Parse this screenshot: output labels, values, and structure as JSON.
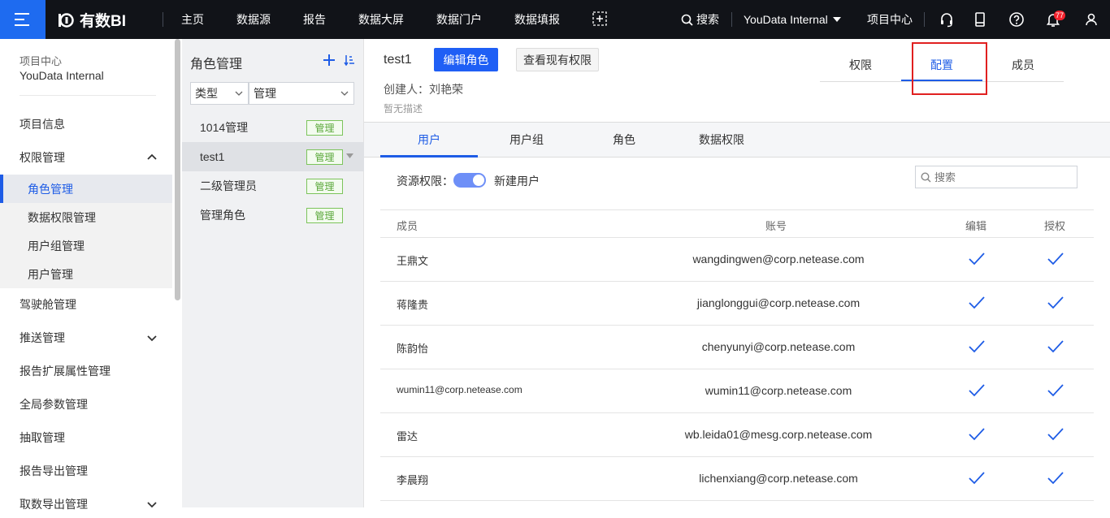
{
  "topbar": {
    "logo": "有数BI",
    "nav": [
      "主页",
      "数据源",
      "报告",
      "数据大屏",
      "数据门户",
      "数据填报"
    ],
    "search_label": "搜索",
    "project": "YouData Internal",
    "project_center": "项目中心",
    "notification_count": "77"
  },
  "sidebar": {
    "header_label": "项目中心",
    "header_project": "YouData Internal",
    "items": [
      {
        "label": "项目信息"
      },
      {
        "label": "权限管理"
      },
      {
        "label": "驾驶舱管理"
      },
      {
        "label": "推送管理"
      },
      {
        "label": "报告扩展属性管理"
      },
      {
        "label": "全局参数管理"
      },
      {
        "label": "抽取管理"
      },
      {
        "label": "报告导出管理"
      },
      {
        "label": "取数导出管理"
      }
    ],
    "sub_items": [
      {
        "label": "角色管理"
      },
      {
        "label": "数据权限管理"
      },
      {
        "label": "用户组管理"
      },
      {
        "label": "用户管理"
      }
    ]
  },
  "role_panel": {
    "title": "角色管理",
    "filter_type": "类型",
    "filter_value": "管理",
    "roles": [
      {
        "name": "1014管理",
        "tag": "管理"
      },
      {
        "name": "test1",
        "tag": "管理"
      },
      {
        "name": "二级管理员",
        "tag": "管理"
      },
      {
        "name": "管理角色",
        "tag": "管理"
      }
    ]
  },
  "main": {
    "role_name": "test1",
    "edit_button": "编辑角色",
    "view_button": "查看现有权限",
    "creator": "创建人：刘艳荣",
    "description": "暂无描述",
    "right_tabs": [
      "权限",
      "配置",
      "成员"
    ],
    "sub_tabs": [
      "用户",
      "用户组",
      "角色",
      "数据权限"
    ],
    "resource_label": "资源权限：",
    "resource_option": "新建用户",
    "search_placeholder": "搜索",
    "table_headers": {
      "member": "成员",
      "account": "账号",
      "edit": "编辑",
      "grant": "授权"
    },
    "rows": [
      {
        "member": "王鼎文",
        "account": "wangdingwen@corp.netease.com"
      },
      {
        "member": "蒋隆贵",
        "account": "jianglonggui@corp.netease.com"
      },
      {
        "member": "陈韵怡",
        "account": "chenyunyi@corp.netease.com"
      },
      {
        "member": "wumin11@corp.netease.com",
        "account": "wumin11@corp.netease.com"
      },
      {
        "member": "雷达",
        "account": "wb.leida01@mesg.corp.netease.com"
      },
      {
        "member": "李晨翔",
        "account": "lichenxiang@corp.netease.com"
      }
    ]
  },
  "colors": {
    "accent": "#1e5ce6",
    "topbar": "#111318",
    "tag_green": "#5aa83a",
    "highlight": "#e02020"
  }
}
